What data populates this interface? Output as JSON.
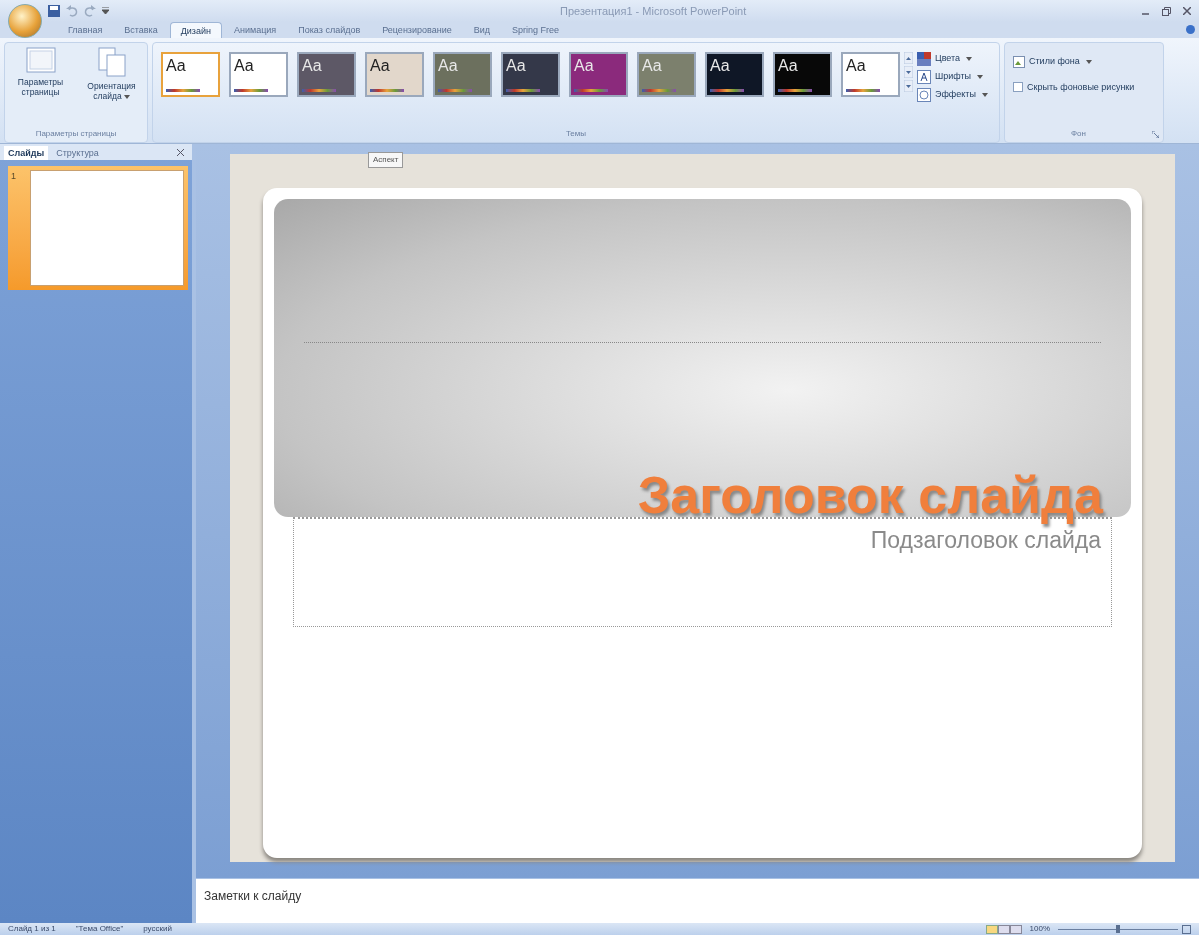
{
  "window": {
    "title": "Презентация1 - Microsoft PowerPoint"
  },
  "ribbon_tabs": [
    {
      "label": "Главная",
      "selected": false
    },
    {
      "label": "Вставка",
      "selected": false
    },
    {
      "label": "Дизайн",
      "selected": true
    },
    {
      "label": "Анимация",
      "selected": false
    },
    {
      "label": "Показ слайдов",
      "selected": false
    },
    {
      "label": "Рецензирование",
      "selected": false
    },
    {
      "label": "Вид",
      "selected": false
    },
    {
      "label": "Spring Free",
      "selected": false
    }
  ],
  "page_setup": {
    "buttons": [
      {
        "label": "Параметры страницы",
        "kind": "page"
      },
      {
        "label": "Ориентация слайда",
        "kind": "orientation"
      }
    ],
    "group_label": "Параметры страницы"
  },
  "themes": {
    "items": [
      {
        "label": "Aa",
        "color": "#ffffff",
        "selected": true
      },
      {
        "label": "Aa",
        "color": "#ffffff",
        "selected": false
      },
      {
        "label": "Aa",
        "color": "#5d5866",
        "selected": false
      },
      {
        "label": "Aa",
        "color": "#e2d7cb",
        "selected": false
      },
      {
        "label": "Aa",
        "color": "#6c705e",
        "selected": false
      },
      {
        "label": "Aa",
        "color": "#343849",
        "selected": false
      },
      {
        "label": "Aa",
        "color": "#8b2a7c",
        "selected": false
      },
      {
        "label": "Aa",
        "color": "#7c806d",
        "selected": false
      },
      {
        "label": "Aa",
        "color": "#0f1726",
        "selected": false
      },
      {
        "label": "Aa",
        "color": "#080808",
        "selected": false
      },
      {
        "label": "Aa",
        "color": "#ffffff",
        "selected": false
      }
    ],
    "options": [
      {
        "label": "Цвета",
        "kind": "colors"
      },
      {
        "label": "Шрифты",
        "kind": "fonts"
      },
      {
        "label": "Эффекты",
        "kind": "effects"
      }
    ],
    "group_label": "Темы",
    "tooltip": "Аспект"
  },
  "background": {
    "styles_button": "Стили фона",
    "hide_graphics": {
      "label": "Скрыть фоновые рисунки",
      "checked": false
    },
    "group_label": "Фон"
  },
  "pane_tabs": [
    {
      "label": "Слайды",
      "selected": true
    },
    {
      "label": "Структура",
      "selected": false
    }
  ],
  "slides": [
    {
      "number": "1",
      "selected": true
    }
  ],
  "slide": {
    "title": "Заголовок слайда",
    "subtitle": "Подзаголовок слайда"
  },
  "notes": {
    "placeholder": "Заметки к слайду"
  },
  "status_bar": {
    "items": [
      "Слайд 1 из 1",
      "\"Тема Office\"",
      "русский"
    ],
    "zoom": "100%",
    "zoom_slider": {
      "level": 0.5
    }
  }
}
